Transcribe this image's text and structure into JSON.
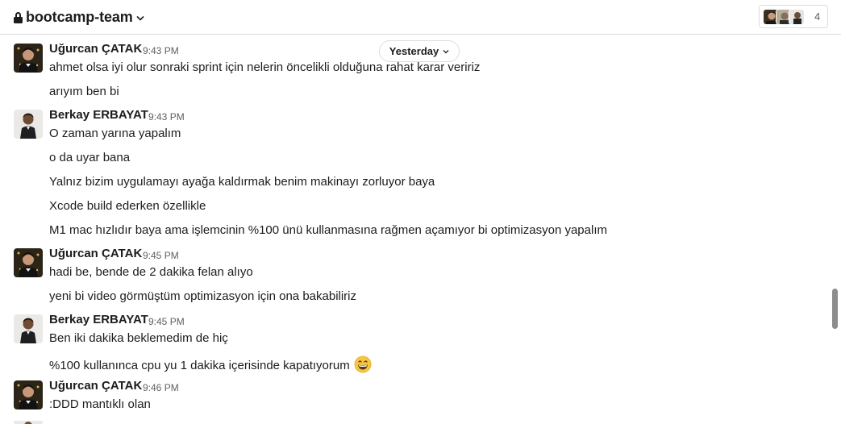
{
  "channel": {
    "name": "bootcamp-team",
    "icon": "lock-icon"
  },
  "members": {
    "count": "4"
  },
  "date_divider": {
    "label": "Yesterday"
  },
  "messages": [
    {
      "sender": "Uğurcan ÇATAK",
      "time": "9:43 PM",
      "lines": [
        "ahmet olsa iyi olur sonraki sprint için nelerin öncelikli olduğuna rahat karar veririz",
        "arıyım ben bi"
      ]
    },
    {
      "sender": "Berkay ERBAYAT",
      "time": "9:43 PM",
      "lines": [
        "O zaman yarına yapalım",
        "o da uyar bana",
        "Yalnız bizim uygulamayı ayağa kaldırmak benim makinayı zorluyor baya",
        "Xcode build ederken özellikle",
        "M1 mac hızlıdır baya ama işlemcinin %100 ünü kullanmasına rağmen açamıyor bi optimizasyon yapalım"
      ]
    },
    {
      "sender": "Uğurcan ÇATAK",
      "time": "9:45 PM",
      "lines": [
        "hadi be, bende de 2 dakika felan alıyo",
        "yeni bi video görmüştüm optimizasyon için ona bakabiliriz"
      ]
    },
    {
      "sender": "Berkay ERBAYAT",
      "time": "9:45 PM",
      "lines": [
        "Ben iki dakika beklemedim de hiç",
        "%100 kullanınca cpu yu 1 dakika içerisinde kapatıyorum"
      ],
      "emoji": "grinning-face-emoji"
    },
    {
      "sender": "Uğurcan ÇATAK",
      "time": "9:46 PM",
      "lines": [
        ":DDD mantıklı olan"
      ]
    }
  ],
  "colors": {
    "text": "#1d1c1d",
    "muted": "#616061",
    "border": "#dddddd"
  }
}
